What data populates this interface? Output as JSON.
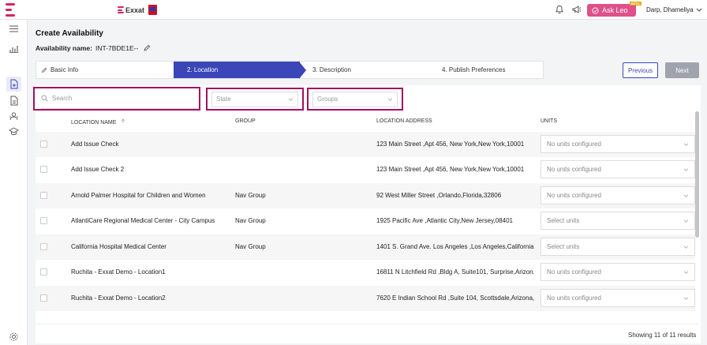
{
  "header": {
    "brand": "Exxat",
    "ask_leo": "Ask Leo",
    "beta": "BETA",
    "user": "Darp, Dhameliya"
  },
  "page": {
    "title": "Create Availability",
    "availability_label": "Availability name:",
    "availability_value": "INT-7BDE1E--"
  },
  "steps": [
    {
      "label": "Basic Info"
    },
    {
      "label": "2. Location"
    },
    {
      "label": "3. Description"
    },
    {
      "label": "4. Publish Preferences"
    }
  ],
  "buttons": {
    "previous": "Previous",
    "next": "Next"
  },
  "filters": {
    "search_placeholder": "Search",
    "state": "State",
    "groups": "Groups"
  },
  "columns": [
    "LOCATION NAME",
    "GROUP",
    "LOCATION ADDRESS",
    "UNITS"
  ],
  "rows": [
    {
      "name": "Add Issue Check",
      "group": "",
      "address": "123 Main Street ,Apt 456, New York,New York,10001",
      "units": "No units configured"
    },
    {
      "name": "Add Issue Check 2",
      "group": "",
      "address": "123 Main Street ,Apt 456, New York,New York,10001",
      "units": "No units configured"
    },
    {
      "name": "Arnold Palmer Hospital for Children and Women",
      "group": "Nav Group",
      "address": "92 West Miller Street ,Orlando,Florida,32806",
      "units": "No units configured"
    },
    {
      "name": "AtlantiCare Regional Medical Center - City Campus",
      "group": "Nav Group",
      "address": "1925 Pacific Ave ,Atlantic City,New Jersey,08401",
      "units": "Select units"
    },
    {
      "name": "California Hospital Medical Center",
      "group": "Nav Group",
      "address": "1401 S. Grand Ave. Los Angeles ,Los Angeles,California,...",
      "units": "Select units"
    },
    {
      "name": "Ruchita - Exxat Demo - Location1",
      "group": "",
      "address": "16811 N Litchfield Rd ,Bldg A, Suite101, Surprise,Arizon...",
      "units": "No units configured"
    },
    {
      "name": "Ruchita - Exxat Demo - Location2",
      "group": "",
      "address": "7620 E Indian School Rd ,Suite 104, Scottsdale,Arizona,...",
      "units": "No units configured"
    }
  ],
  "footer": {
    "results": "Showing 11 of 11 results"
  },
  "colors": {
    "accent": "#3b46b8",
    "brand": "#d6245c",
    "highlight": "#a0125e",
    "ask_leo": "#e0508a"
  }
}
